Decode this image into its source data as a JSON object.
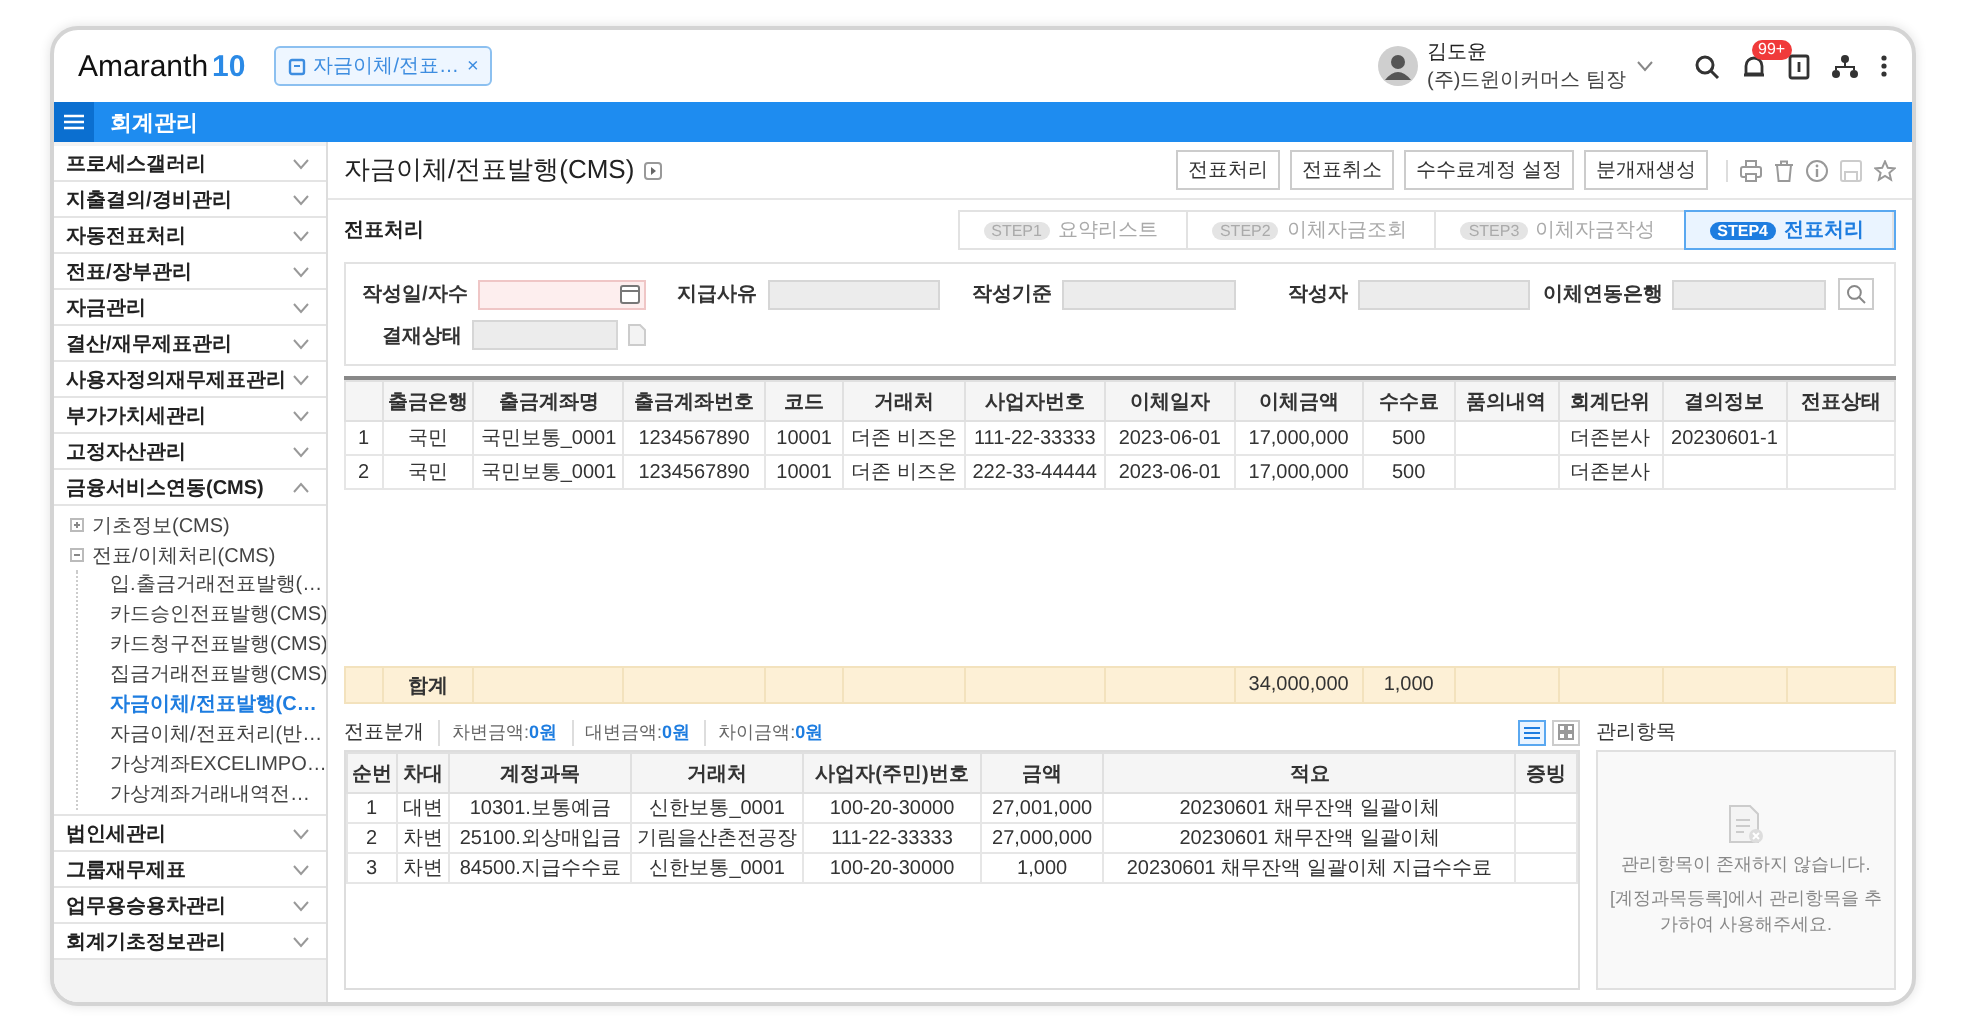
{
  "app": {
    "logo_text": "Amaranth",
    "logo_version": "10",
    "open_tab": {
      "label": "자금이체/전표…",
      "close": "×"
    }
  },
  "user": {
    "name": "김도윤",
    "company": "(주)드윈이커머스 팀장",
    "notification_badge": "99+"
  },
  "module_bar": {
    "title": "회계관리"
  },
  "sidebar": {
    "items": [
      {
        "label": "프로세스갤러리",
        "expanded": false
      },
      {
        "label": "지출결의/경비관리",
        "expanded": false
      },
      {
        "label": "자동전표처리",
        "expanded": false
      },
      {
        "label": "전표/장부관리",
        "expanded": false
      },
      {
        "label": "자금관리",
        "expanded": false
      },
      {
        "label": "결산/재무제표관리",
        "expanded": false
      },
      {
        "label": "사용자정의재무제표관리",
        "expanded": false
      },
      {
        "label": "부가가치세관리",
        "expanded": false
      },
      {
        "label": "고정자산관리",
        "expanded": false
      },
      {
        "label": "금융서비스연동(CMS)",
        "expanded": true,
        "children": [
          {
            "label": "기초정보(CMS)",
            "expanded": false
          },
          {
            "label": "전표/이체처리(CMS)",
            "expanded": true,
            "children": [
              {
                "label": "입.출금거래전표발행(…",
                "selected": false
              },
              {
                "label": "카드승인전표발행(CMS)",
                "selected": false
              },
              {
                "label": "카드청구전표발행(CMS)",
                "selected": false
              },
              {
                "label": "집금거래전표발행(CMS)",
                "selected": false
              },
              {
                "label": "자금이체/전표발행(C…",
                "selected": true
              },
              {
                "label": "자금이체/전표처리(반…",
                "selected": false
              },
              {
                "label": "가상계좌EXCELIMPO…",
                "selected": false
              },
              {
                "label": "가상계좌거래내역전…",
                "selected": false
              }
            ]
          }
        ]
      },
      {
        "label": "법인세관리",
        "expanded": false
      },
      {
        "label": "그룹재무제표",
        "expanded": false
      },
      {
        "label": "업무용승용차관리",
        "expanded": false
      },
      {
        "label": "회계기초정보관리",
        "expanded": false
      }
    ]
  },
  "page": {
    "title": "자금이체/전표발행(CMS)",
    "actions": [
      "전표처리",
      "전표취소",
      "수수료계정 설정",
      "분개재생성"
    ]
  },
  "section_title": "전표처리",
  "steps": [
    {
      "badge": "STEP1",
      "label": "요약리스트",
      "selected": false
    },
    {
      "badge": "STEP2",
      "label": "이체자금조회",
      "selected": false
    },
    {
      "badge": "STEP3",
      "label": "이체자금작성",
      "selected": false
    },
    {
      "badge": "STEP4",
      "label": "전표처리",
      "selected": true
    }
  ],
  "filters": [
    {
      "label": "작성일/자수",
      "kind": "date",
      "required": true
    },
    {
      "label": "지급사유",
      "kind": "text",
      "required": false
    },
    {
      "label": "작성기준",
      "kind": "text",
      "required": false
    },
    {
      "label": "작성자",
      "kind": "text",
      "required": false
    },
    {
      "label": "이체연동은행",
      "kind": "text",
      "required": false
    },
    {
      "label": "결재상태",
      "kind": "status",
      "required": false
    }
  ],
  "transfers": {
    "columns": [
      "출금은행",
      "출금계좌명",
      "출금계좌번호",
      "코드",
      "거래처",
      "사업자번호",
      "이체일자",
      "이체금액",
      "수수료",
      "품의내역",
      "회계단위",
      "결의정보",
      "전표상태"
    ],
    "rows": [
      {
        "no": "1",
        "cells": [
          "국민",
          "국민보통_0001",
          "1234567890",
          "10001",
          "더존 비즈온",
          "111-22-33333",
          "2023-06-01",
          "17,000,000",
          "500",
          null,
          "더존본사",
          "20230601-1",
          null
        ]
      },
      {
        "no": "2",
        "cells": [
          "국민",
          "국민보통_0001",
          "1234567890",
          "10001",
          "더존 비즈온",
          "222-33-44444",
          "2023-06-01",
          "17,000,000",
          "500",
          null,
          "더존본사",
          null,
          null
        ]
      }
    ],
    "total": {
      "label": "합계",
      "amount": "34,000,000",
      "fee": "1,000"
    }
  },
  "journal": {
    "title": "전표분개",
    "summary": [
      {
        "label": "차변금액:",
        "value": "0원"
      },
      {
        "label": "대변금액:",
        "value": "0원"
      },
      {
        "label": "차이금액:",
        "value": "0원"
      }
    ],
    "view_modes": [
      {
        "kind": "list",
        "selected": true
      },
      {
        "kind": "grid",
        "selected": false
      }
    ],
    "columns": [
      "순번",
      "차대",
      "계정과목",
      "거래처",
      "사업자(주민)번호",
      "금액",
      "적요",
      "증빙"
    ],
    "rows": [
      [
        "1",
        "대변",
        "10301.보통예금",
        "신한보통_0001",
        "100-20-30000",
        "27,001,000",
        "20230601 채무잔액 일괄이체",
        null
      ],
      [
        "2",
        "차변",
        "25100.외상매입금",
        "기림을산촌전공장",
        "111-22-33333",
        "27,000,000",
        "20230601 채무잔액 일괄이체",
        null
      ],
      [
        "3",
        "차변",
        "84500.지급수수료",
        "신한보통_0001",
        "100-20-30000",
        "1,000",
        "20230601 채무잔액 일괄이체 지급수수료",
        null
      ]
    ]
  },
  "management": {
    "title": "관리항목",
    "empty_message": "관리항목이 존재하지 않습니다.",
    "hint": "[계정과목등록]에서 관리항목을 추가하여 사용해주세요."
  }
}
